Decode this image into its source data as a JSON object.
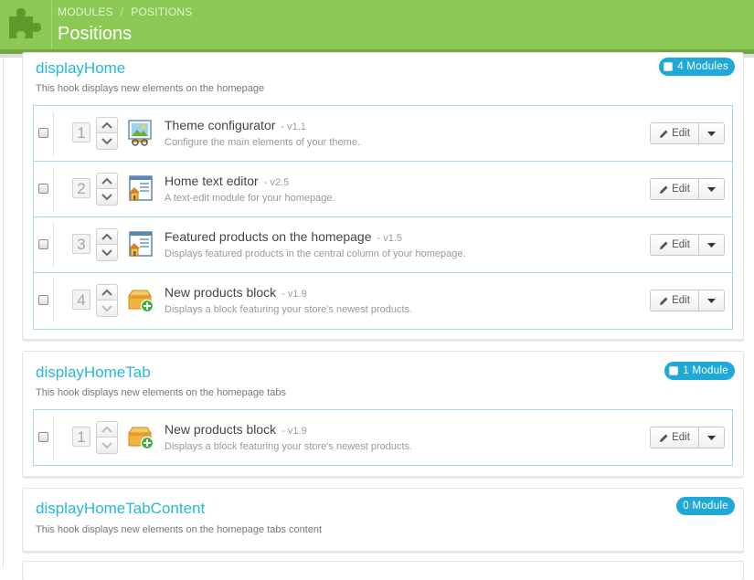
{
  "header": {
    "breadcrumb": [
      "MODULES",
      "POSITIONS"
    ],
    "breadcrumb_sep": "/",
    "title": "Positions",
    "icon": "puzzle-icon"
  },
  "colors": {
    "header": "#8bc954",
    "accent": "#25b9d7",
    "badge": "#1ea9d6"
  },
  "edit_label": "Edit",
  "hooks": [
    {
      "name": "displayHome",
      "description": "This hook displays new elements on the homepage",
      "badge": "4 Modules",
      "modules": [
        {
          "position": "1",
          "name": "Theme configurator",
          "version": "- v1.1",
          "description": "Configure the main elements of your theme.",
          "icon": "theme-configurator-icon"
        },
        {
          "position": "2",
          "name": "Home text editor",
          "version": "- v2.5",
          "description": "A text-edit module for your homepage.",
          "icon": "home-page-icon"
        },
        {
          "position": "3",
          "name": "Featured products on the homepage",
          "version": "- v1.5",
          "description": "Displays featured products in the central column of your homepage.",
          "icon": "home-page-icon"
        },
        {
          "position": "4",
          "name": "New products block",
          "version": "- v1.9",
          "description": "Displays a block featuring your store's newest products.",
          "icon": "new-products-box-icon"
        }
      ]
    },
    {
      "name": "displayHomeTab",
      "description": "This hook displays new elements on the homepage tabs",
      "badge": "1 Module",
      "modules": [
        {
          "position": "1",
          "name": "New products block",
          "version": "- v1.9",
          "description": "Displays a block featuring your store's newest products.",
          "icon": "new-products-box-icon"
        }
      ]
    },
    {
      "name": "displayHomeTabContent",
      "description": "This hook displays new elements on the homepage tabs content",
      "badge": "0 Module",
      "modules": []
    }
  ]
}
